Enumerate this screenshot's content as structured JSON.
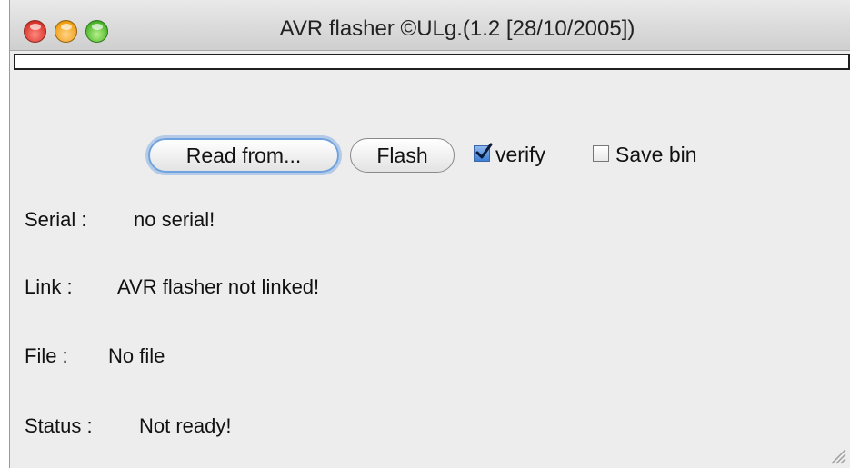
{
  "window": {
    "title": "AVR flasher ©ULg.(1.2 [28/10/2005])"
  },
  "progress": {
    "value": 0
  },
  "toolbar": {
    "read_label": "Read from...",
    "flash_label": "Flash",
    "verify_label": "verify",
    "verify_checked": true,
    "save_bin_label": "Save bin",
    "save_bin_checked": false
  },
  "info": {
    "serial_label": "Serial :",
    "serial_value": "no serial!",
    "link_label": "Link :",
    "link_value": "AVR flasher not linked!",
    "file_label": "File :",
    "file_value": "No file",
    "status_label": "Status :",
    "status_value": "Not ready!"
  },
  "colors": {
    "window_bg": "#ededed",
    "focus_ring": "#6fa3e0",
    "checkbox_checked": "#3d7fd3"
  }
}
